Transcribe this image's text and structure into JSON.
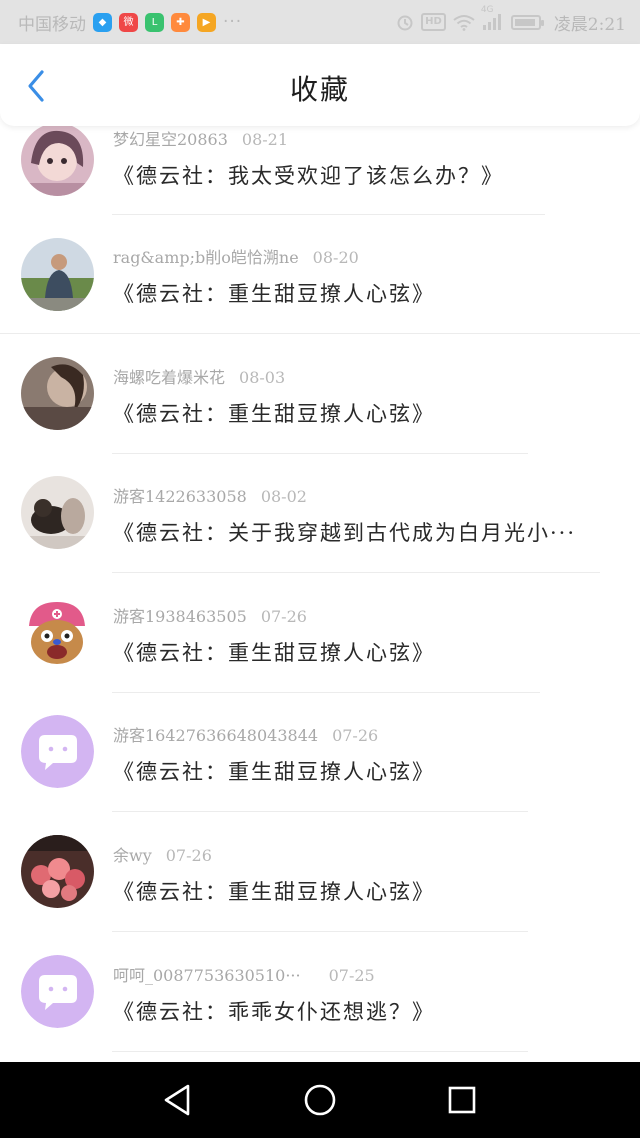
{
  "statusbar": {
    "carrier": "中国移动",
    "app_icons": [
      {
        "name": "shield-app-icon",
        "color": "#2aa0f0",
        "glyph": "◆"
      },
      {
        "name": "weibo-app-icon",
        "color": "#ef4747",
        "glyph": "微"
      },
      {
        "name": "messenger-app-icon",
        "color": "#39c26f",
        "glyph": "L"
      },
      {
        "name": "tools-app-icon",
        "color": "#ff8a3d",
        "glyph": "✚"
      },
      {
        "name": "video-app-icon",
        "color": "#f5a623",
        "glyph": "▶"
      }
    ],
    "more": "···",
    "hd": "HD",
    "network": "4G",
    "time": "凌晨2:21"
  },
  "header": {
    "title": "收藏"
  },
  "items": [
    {
      "user": "梦幻星空20863",
      "date": "08-21",
      "title": "《德云社：我太受欢迎了该怎么办？》",
      "avatar": "photo-girl"
    },
    {
      "user": "rag&amp;b削o皑恰溯ne",
      "date": "08-20",
      "title": "《德云社：重生甜豆撩人心弦》",
      "avatar": "photo-man"
    },
    {
      "user": "海螺吃着爆米花",
      "date": "08-03",
      "title": "《德云社：重生甜豆撩人心弦》",
      "avatar": "photo-dark"
    },
    {
      "user": "游客1422633058",
      "date": "08-02",
      "title": "《德云社：关于我穿越到古代成为白月光小···",
      "avatar": "photo-dog"
    },
    {
      "user": "游客1938463505",
      "date": "07-26",
      "title": "《德云社：重生甜豆撩人心弦》",
      "avatar": "cartoon-chopper"
    },
    {
      "user": "游客16427636648043844",
      "date": "07-26",
      "title": "《德云社：重生甜豆撩人心弦》",
      "avatar": "default-chat"
    },
    {
      "user": "余wy",
      "date": "07-26",
      "title": "《德云社：重生甜豆撩人心弦》",
      "avatar": "photo-flowers"
    },
    {
      "user": "呵呵_0087753630510···",
      "date": "07-25",
      "title": "《德云社：乖乖女仆还想逃？》",
      "avatar": "default-chat"
    }
  ],
  "colors": {
    "accent_back": "#3a8ee6",
    "default_avatar": "#d3b5f2"
  }
}
